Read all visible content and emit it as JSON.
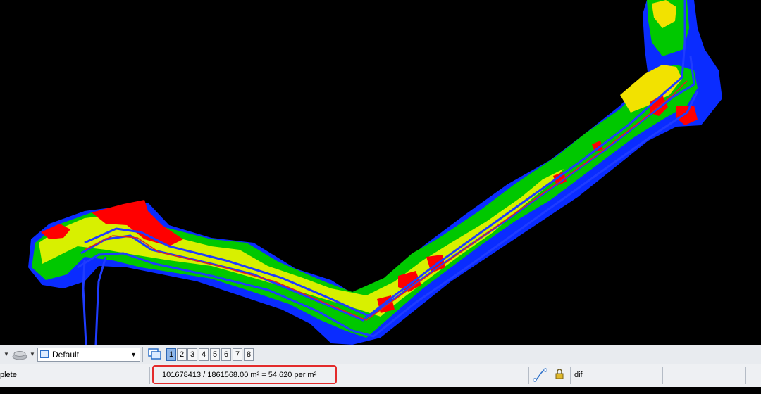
{
  "toolbar": {
    "style_select_value": "Default",
    "view_buttons": [
      "1",
      "2",
      "3",
      "4",
      "5",
      "6",
      "7",
      "8"
    ],
    "active_view": "1"
  },
  "status": {
    "left_text": "plete",
    "message": "101678413 / 1861568.00 m² = 54.620 per m²",
    "level": "dif"
  },
  "viewport": {
    "colors": {
      "background": "#000000",
      "low": "#0022ff",
      "mid_low": "#00cc00",
      "mid": "#ccff33",
      "mid_high": "#f2e400",
      "high": "#ff0000",
      "alignment_line": "#1f3cff",
      "edge_line": "#e02020"
    }
  }
}
